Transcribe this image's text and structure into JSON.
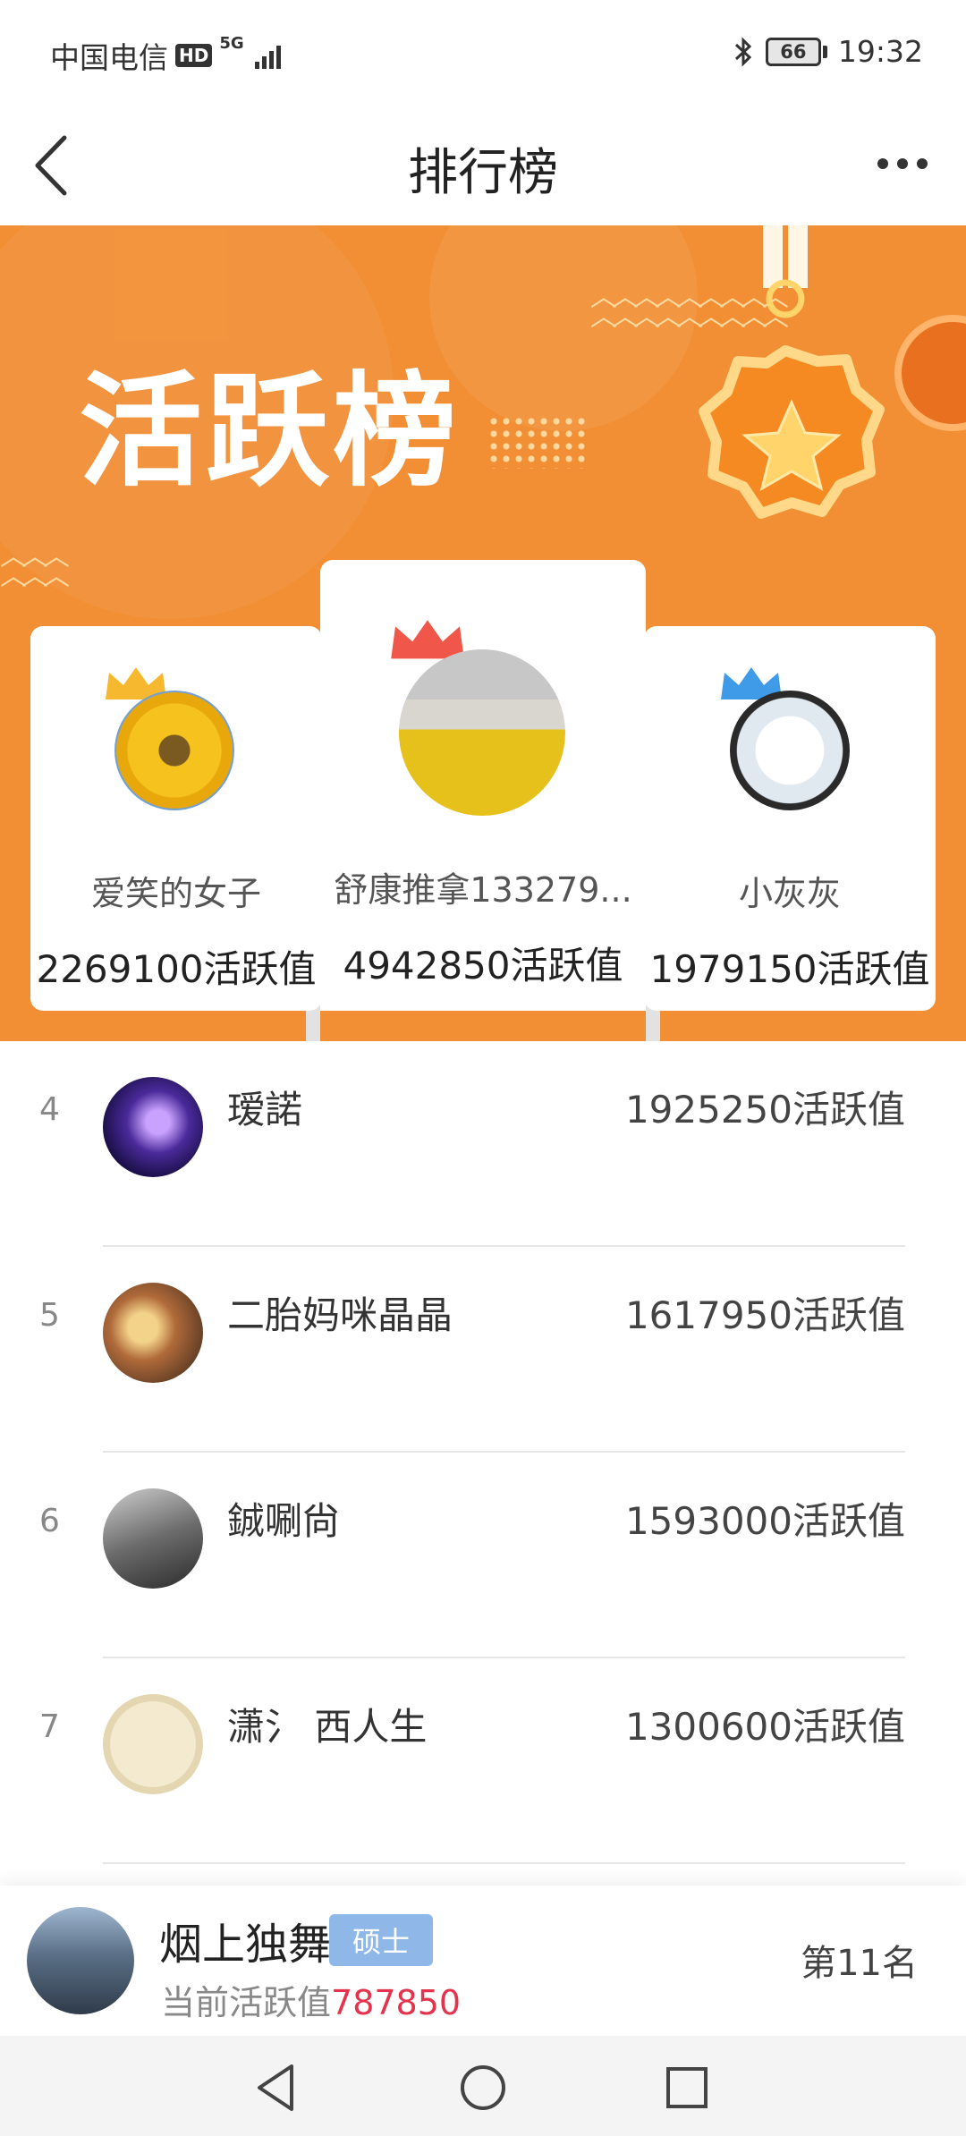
{
  "status_bar": {
    "carrier": "中国电信",
    "hd": "HD",
    "network": "5G",
    "battery": "66",
    "time": "19:32"
  },
  "nav": {
    "title": "排行榜",
    "back_icon": "back-chevron-icon",
    "more_icon": "more-dots-icon"
  },
  "banner": {
    "title": "活跃榜"
  },
  "podium": [
    {
      "rank": 2,
      "name": "爱笑的女子",
      "score": "2269100活跃值",
      "crown_color": "#f5b82e"
    },
    {
      "rank": 1,
      "name": "舒康推拿133279...",
      "score": "4942850活跃值",
      "crown_color": "#f0564a"
    },
    {
      "rank": 3,
      "name": "小灰灰",
      "score": "1979150活跃值",
      "crown_color": "#3f9be8"
    }
  ],
  "list": [
    {
      "rank": "4",
      "name": "瑷諾",
      "score": "1925250活跃值"
    },
    {
      "rank": "5",
      "name": "二胎妈咪晶晶",
      "score": "1617950活跃值"
    },
    {
      "rank": "6",
      "name": "鋮唰尙",
      "score": "1593000活跃值"
    },
    {
      "rank": "7",
      "name": "潇氵 西人生",
      "score": "1300600活跃值"
    }
  ],
  "me": {
    "name": "烟上独舞",
    "badge": "硕士",
    "score_label": "当前活跃值",
    "score_value": "787850",
    "rank_text": "第11名"
  },
  "colors": {
    "banner": "#f28e33",
    "score_highlight": "#e4334c",
    "badge": "#8fb8e9"
  }
}
